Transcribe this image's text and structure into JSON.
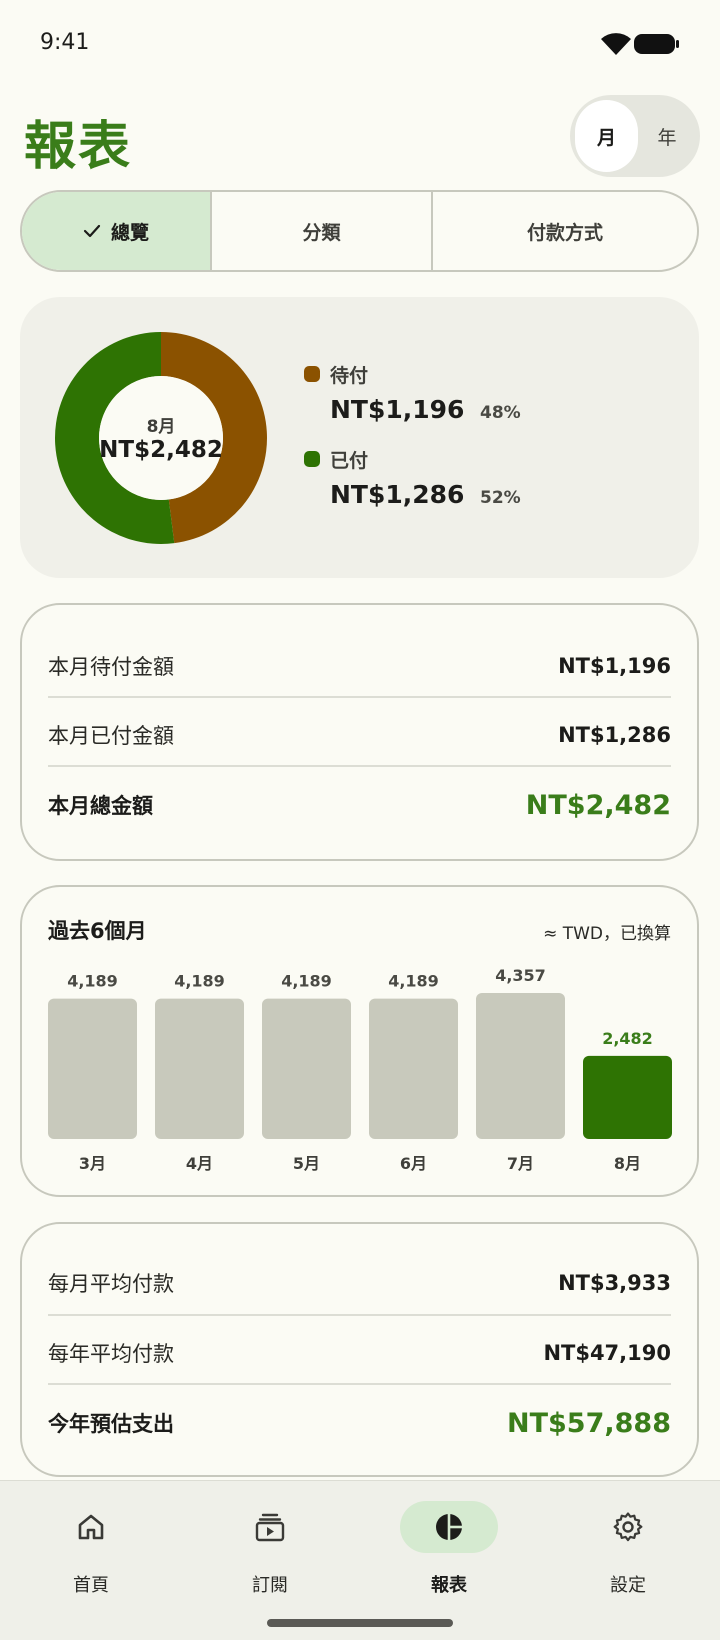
{
  "status": {
    "time": "9:41"
  },
  "header": {
    "title": "報表",
    "period_month": "月",
    "period_year": "年"
  },
  "tabs": [
    {
      "label": "總覽",
      "selected": true
    },
    {
      "label": "分類",
      "selected": false
    },
    {
      "label": "付款方式",
      "selected": false
    }
  ],
  "overview": {
    "center_label": "8月",
    "center_total": "NT$2,482",
    "legend": [
      {
        "name": "待付",
        "amount": "NT$1,196",
        "percent": "48%",
        "fraction": 0.48,
        "color": "#8b5200"
      },
      {
        "name": "已付",
        "amount": "NT$1,286",
        "percent": "52%",
        "fraction": 0.52,
        "color": "#2e7303"
      }
    ]
  },
  "month_summary": {
    "rows": [
      {
        "label": "本月待付金額",
        "value": "NT$1,196"
      },
      {
        "label": "本月已付金額",
        "value": "NT$1,286"
      }
    ],
    "total_label": "本月總金額",
    "total_value": "NT$2,482"
  },
  "history": {
    "title": "過去6個月",
    "note": "≈ TWD，已換算"
  },
  "chart_data": {
    "type": "bar",
    "categories": [
      "3月",
      "4月",
      "5月",
      "6月",
      "7月",
      "8月"
    ],
    "values": [
      4189,
      4189,
      4189,
      4189,
      4357,
      2482
    ],
    "value_labels": [
      "4,189",
      "4,189",
      "4,189",
      "4,189",
      "4,357",
      "2,482"
    ],
    "highlight_index": 5,
    "colors": {
      "default": "#c8c9bc",
      "highlight": "#2e7303",
      "highlight_label": "#3a7d1a"
    },
    "ylim": [
      0,
      4357
    ],
    "grid": false,
    "title": "過去6個月",
    "xlabel": "",
    "ylabel": ""
  },
  "annual_summary": {
    "rows": [
      {
        "label": "每月平均付款",
        "value": "NT$3,933"
      },
      {
        "label": "每年平均付款",
        "value": "NT$47,190"
      }
    ],
    "total_label": "今年預估支出",
    "total_value": "NT$57,888"
  },
  "bottom_nav": [
    {
      "label": "首頁",
      "icon": "home-icon",
      "selected": false
    },
    {
      "label": "訂閱",
      "icon": "subscriptions-icon",
      "selected": false
    },
    {
      "label": "報表",
      "icon": "reports-pie-icon",
      "selected": true
    },
    {
      "label": "設定",
      "icon": "settings-gear-icon",
      "selected": false
    }
  ],
  "colors": {
    "accent": "#3a7d1a",
    "selected_tint": "#d5ead0",
    "background": "#fbfbf4"
  }
}
